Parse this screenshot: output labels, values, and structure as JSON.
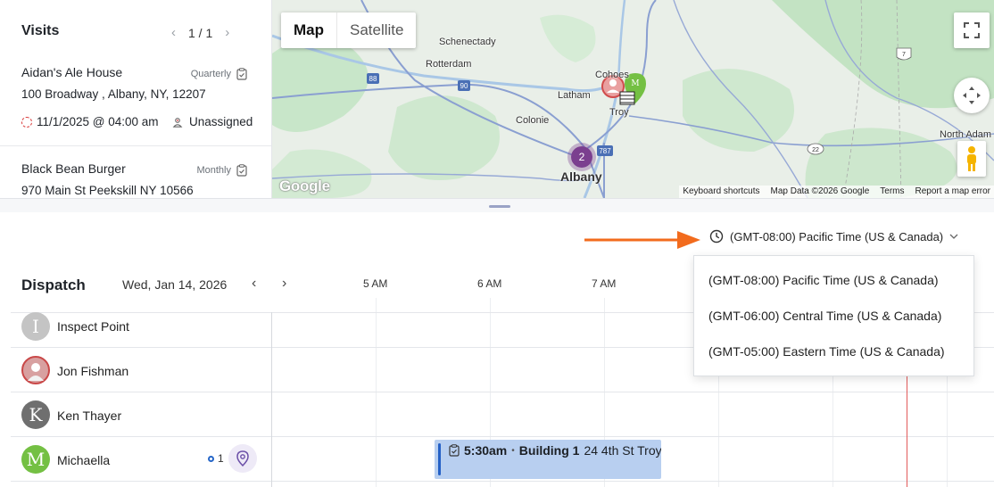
{
  "visits": {
    "title": "Visits",
    "pager": "1 / 1",
    "items": [
      {
        "name": "Aidan's Ale House",
        "frequency": "Quarterly",
        "address": "100 Broadway , Albany, NY, 12207",
        "when": "11/1/2025 @ 04:00 am",
        "assignee": "Unassigned"
      },
      {
        "name": "Black Bean Burger",
        "frequency": "Monthly",
        "address": "970 Main St Peekskill NY 10566"
      }
    ]
  },
  "map": {
    "map_label": "Map",
    "satellite_label": "Satellite",
    "places": {
      "schenectady": "Schenectady",
      "rotterdam": "Rotterdam",
      "latham": "Latham",
      "cohoes": "Cohoes",
      "troy": "Troy",
      "colonie": "Colonie",
      "albany": "Albany",
      "north_adams": "North Adam"
    },
    "shields": {
      "i88": "88",
      "i90": "90",
      "i787": "787",
      "r22": "22",
      "r7": "7"
    },
    "cluster_count": "2",
    "marker_letter": "M",
    "google": "Google",
    "footer": {
      "shortcuts": "Keyboard shortcuts",
      "map_data": "Map Data ©2026 Google",
      "terms": "Terms",
      "report": "Report a map error"
    }
  },
  "timezone": {
    "selected": "(GMT-08:00) Pacific Time (US & Canada)",
    "options": [
      "(GMT-08:00) Pacific Time (US & Canada)",
      "(GMT-06:00) Central Time (US & Canada)",
      "(GMT-05:00) Eastern Time (US & Canada)"
    ]
  },
  "dispatch": {
    "title": "Dispatch",
    "date": "Wed, Jan 14, 2026",
    "hours": [
      "5 AM",
      "6 AM",
      "7 AM"
    ],
    "techs": [
      {
        "initial": "I",
        "name": "Inspect Point",
        "color": "#c4c4c4"
      },
      {
        "initial": "",
        "name": "Jon Fishman",
        "color": "#d8a0a0"
      },
      {
        "initial": "K",
        "name": "Ken Thayer",
        "color": "#6f6f6f"
      },
      {
        "initial": "M",
        "name": "Michaella",
        "color": "#74c043",
        "badge_count": "1"
      }
    ],
    "job": {
      "time": "5:30am",
      "separator": "•",
      "building": "Building 1",
      "address": "24 4th St Troy"
    }
  },
  "colors": {
    "accent": "#2561c6",
    "arrow": "#f26b1d",
    "cluster": "#7b3f8f",
    "now_line": "#e25b5b"
  }
}
